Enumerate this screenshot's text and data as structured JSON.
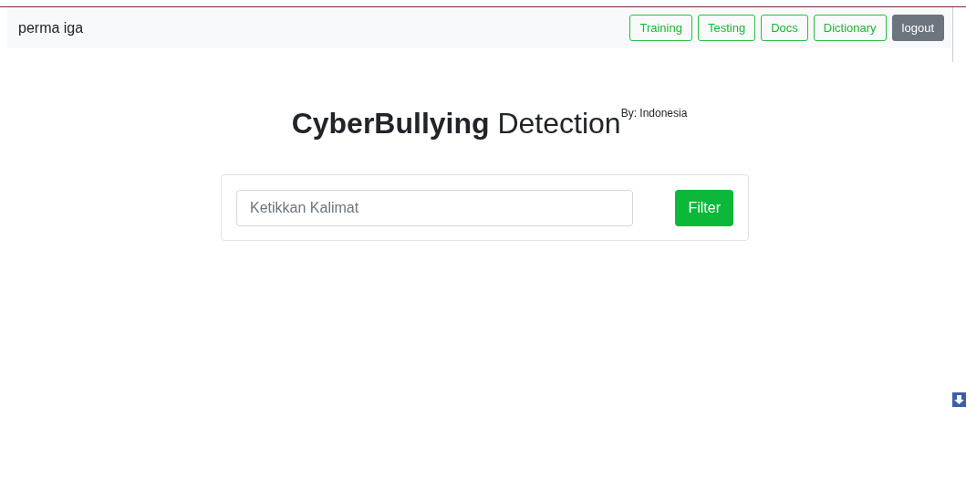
{
  "navbar": {
    "brand": "perma iga",
    "links": [
      {
        "label": "Training",
        "kind": "outline"
      },
      {
        "label": "Testing",
        "kind": "outline"
      },
      {
        "label": "Docs",
        "kind": "outline"
      },
      {
        "label": "Dictionary",
        "kind": "outline"
      },
      {
        "label": "logout",
        "kind": "solid"
      }
    ]
  },
  "heading": {
    "bold": "CyberBullying",
    "rest": "Detection",
    "superscript": "By: Indonesia"
  },
  "search": {
    "placeholder": "Ketikkan Kalimat",
    "button": "Filter"
  }
}
